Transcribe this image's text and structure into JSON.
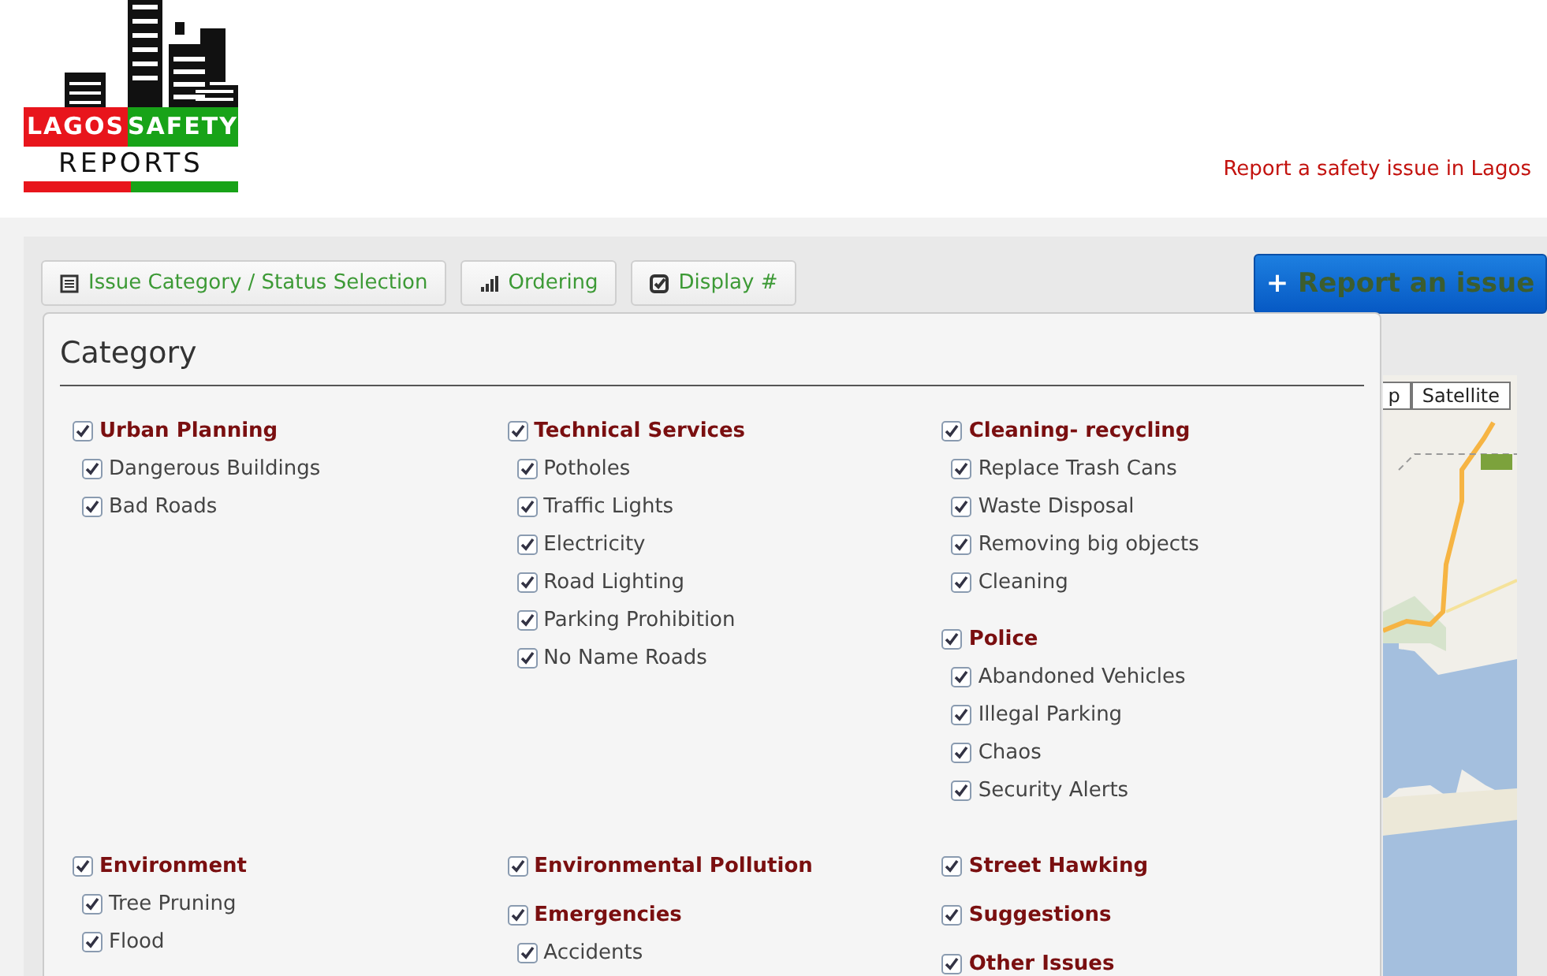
{
  "logo": {
    "word_1": "LAGOS",
    "word_2": "SAFETY",
    "word_3": "REPORTS"
  },
  "header_link": "Report a safety issue in Lagos",
  "toolbar": [
    {
      "label": "Issue Category / Status Selection"
    },
    {
      "label": "Ordering"
    },
    {
      "label": "Display #"
    }
  ],
  "report_button": {
    "icon": "+",
    "label": "Report an issue"
  },
  "map_types": [
    "p",
    "Satellite"
  ],
  "category_panel": {
    "title": "Category",
    "rows": [
      {
        "columns": [
          [
            {
              "name": "Urban Planning",
              "checked": true,
              "children": [
                {
                  "name": "Dangerous Buildings",
                  "checked": true
                },
                {
                  "name": "Bad Roads",
                  "checked": true
                }
              ]
            }
          ],
          [
            {
              "name": "Technical Services",
              "checked": true,
              "children": [
                {
                  "name": "Potholes",
                  "checked": true
                },
                {
                  "name": "Traffic Lights",
                  "checked": true
                },
                {
                  "name": "Electricity",
                  "checked": true
                },
                {
                  "name": "Road Lighting",
                  "checked": true
                },
                {
                  "name": "Parking Prohibition",
                  "checked": true
                },
                {
                  "name": "No Name Roads",
                  "checked": true
                }
              ]
            }
          ],
          [
            {
              "name": "Cleaning- recycling",
              "checked": true,
              "children": [
                {
                  "name": "Replace Trash Cans",
                  "checked": true
                },
                {
                  "name": "Waste Disposal",
                  "checked": true
                },
                {
                  "name": "Removing big objects",
                  "checked": true
                },
                {
                  "name": "Cleaning",
                  "checked": true
                }
              ]
            },
            {
              "name": "Police",
              "checked": true,
              "children": [
                {
                  "name": "Abandoned Vehicles",
                  "checked": true
                },
                {
                  "name": "Illegal Parking",
                  "checked": true
                },
                {
                  "name": "Chaos",
                  "checked": true
                },
                {
                  "name": "Security Alerts",
                  "checked": true
                }
              ]
            }
          ]
        ]
      },
      {
        "columns": [
          [
            {
              "name": "Environment",
              "checked": true,
              "children": [
                {
                  "name": "Tree Pruning",
                  "checked": true
                },
                {
                  "name": "Flood",
                  "checked": true
                }
              ]
            }
          ],
          [
            {
              "name": "Environmental Pollution",
              "checked": true
            },
            {
              "name": "Emergencies",
              "checked": true,
              "children": [
                {
                  "name": "Accidents",
                  "checked": true
                }
              ]
            }
          ],
          [
            {
              "name": "Street Hawking",
              "checked": true
            },
            {
              "name": "Suggestions",
              "checked": true
            },
            {
              "name": "Other Issues",
              "checked": true
            }
          ]
        ]
      }
    ]
  }
}
